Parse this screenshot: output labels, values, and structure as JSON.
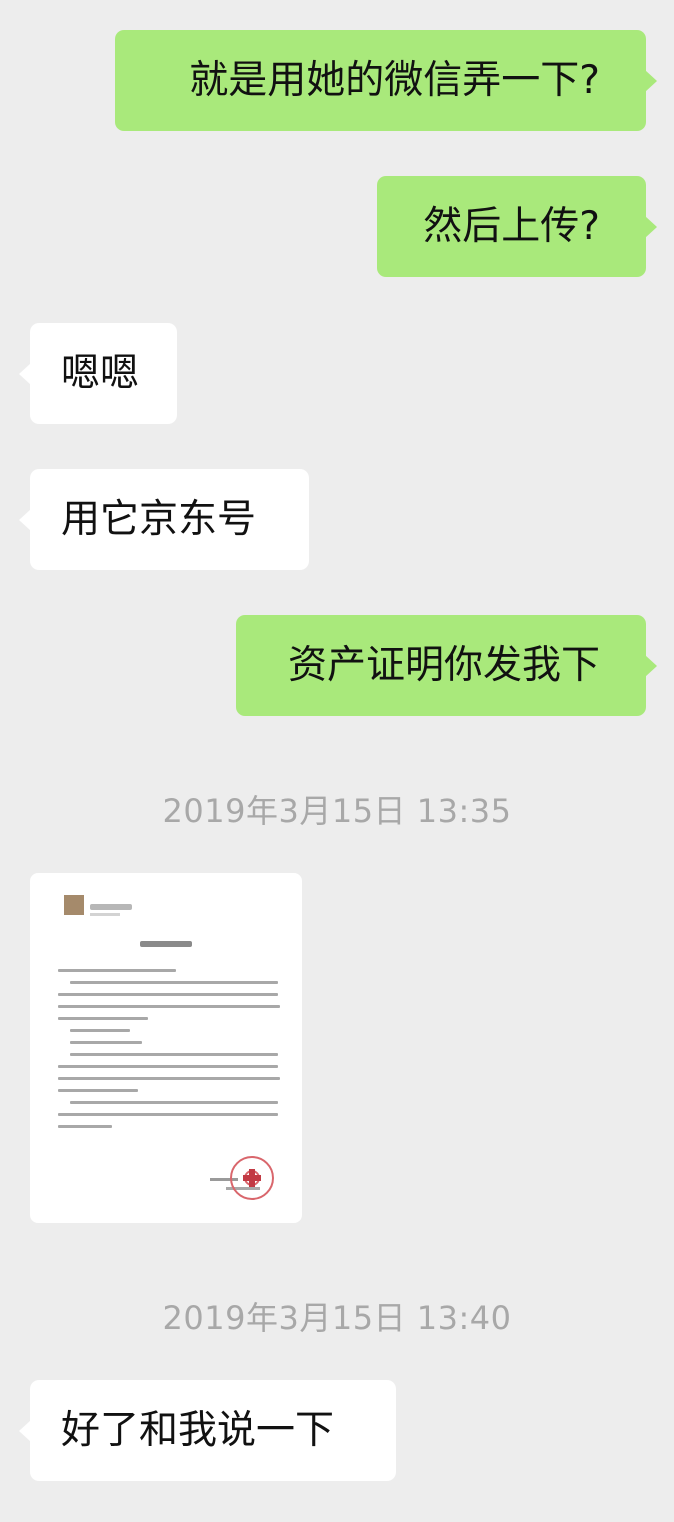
{
  "messages": [
    {
      "direction": "out",
      "text": "就是用她的微信弄一下?"
    },
    {
      "direction": "out",
      "text": "然后上传?"
    },
    {
      "direction": "in",
      "text": "嗯嗯"
    },
    {
      "direction": "in",
      "text": "用它京东号"
    },
    {
      "direction": "out",
      "text": "资产证明你发我下"
    }
  ],
  "timestamps": [
    "2019年3月15日 13:35",
    "2019年3月15日 13:40"
  ],
  "final_message": {
    "direction": "in",
    "text": "好了和我说一下"
  },
  "image_message": {
    "kind": "document-photo",
    "seal": "red-seal"
  },
  "colors": {
    "background": "#ededed",
    "outgoing_bubble": "#a9e97b",
    "incoming_bubble": "#ffffff",
    "timestamp_text": "#a8a8a8",
    "seal": "#d9666c"
  }
}
